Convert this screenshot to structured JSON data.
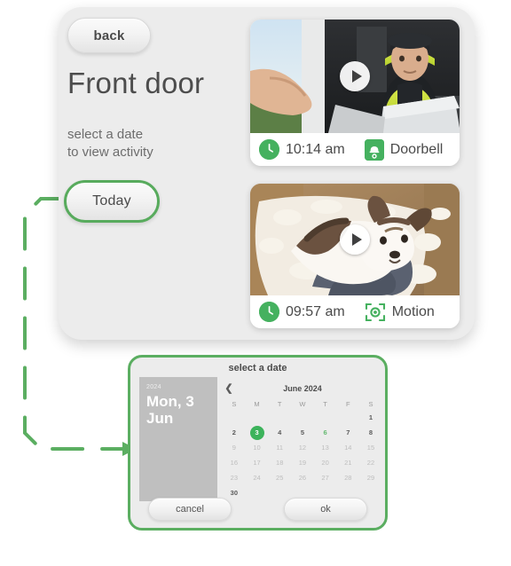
{
  "app": {
    "back_label": "back",
    "page_title": "Front door",
    "subtitle_line1": "select a date",
    "subtitle_line2": "to view activity",
    "today_label": "Today"
  },
  "events": [
    {
      "time": "10:14 am",
      "type": "Doorbell",
      "clock_icon": "clock-icon",
      "type_icon": "doorbell-icon",
      "play_icon": "play-icon",
      "thumbnail_alt": "delivery courier in hi-vis vest holding a parcel at the door"
    },
    {
      "time": "09:57 am",
      "type": "Motion",
      "clock_icon": "clock-icon",
      "type_icon": "motion-icon",
      "play_icon": "play-icon",
      "thumbnail_alt": "dog lying on floor surrounded by shredded pillow stuffing"
    }
  ],
  "date_picker": {
    "title": "select a date",
    "selected_year": "2024",
    "selected_date": "Mon, 3\nJun",
    "month_label": "June 2024",
    "prev_month_icon": "chevron-left-icon",
    "weekdays": [
      "S",
      "M",
      "T",
      "W",
      "T",
      "F",
      "S"
    ],
    "weeks": [
      [
        "",
        "",
        "",
        "",
        "",
        "",
        "1"
      ],
      [
        "2",
        "3",
        "4",
        "5",
        "6",
        "7",
        "8"
      ],
      [
        "9",
        "10",
        "11",
        "12",
        "13",
        "14",
        "15"
      ],
      [
        "16",
        "17",
        "18",
        "19",
        "20",
        "21",
        "22"
      ],
      [
        "23",
        "24",
        "25",
        "26",
        "27",
        "28",
        "29"
      ],
      [
        "30",
        "",
        "",
        "",
        "",
        "",
        ""
      ]
    ],
    "selected_day": "3",
    "today_day": "6",
    "cancel_label": "cancel",
    "ok_label": "ok"
  },
  "colors": {
    "accent_green": "#58ab5d",
    "selected_green": "#3cb35b",
    "icon_green": "#45b15f",
    "panel_gray": "#ececec",
    "text_gray": "#4d4d4d"
  }
}
